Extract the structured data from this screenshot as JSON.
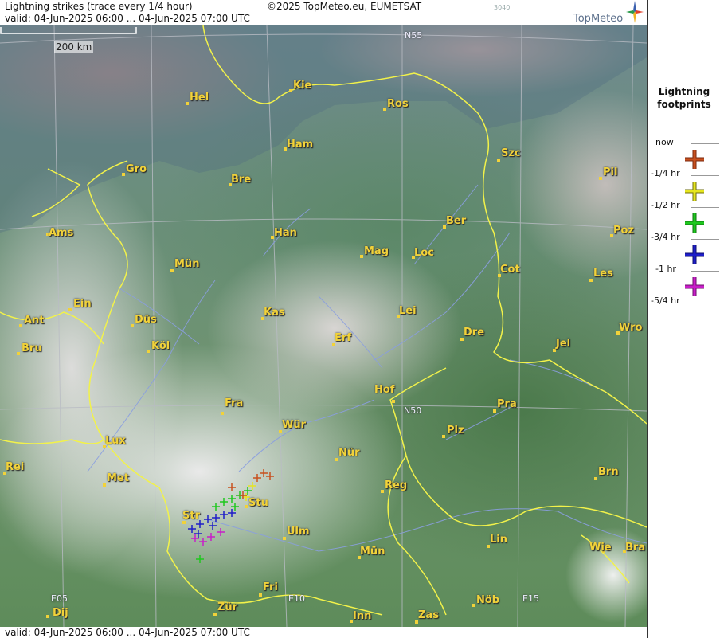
{
  "header": {
    "title": "Lightning strikes (trace every 1/4 hour)",
    "valid": "valid:  04-Jun-2025 06:00 ... 04-Jun-2025 07:00 UTC",
    "copyright": "©2025 TopMeteo.eu, EUMETSAT",
    "code": "3040",
    "brand": "TopMeteo"
  },
  "footer": {
    "valid": "valid:  04-Jun-2025 06:00 ... 04-Jun-2025 07:00 UTC"
  },
  "scale": {
    "label": "200 km"
  },
  "grid_labels": {
    "n55": "N55",
    "n50": "N50",
    "e05": "E05",
    "e10": "E10",
    "e15": "E15"
  },
  "cities": [
    {
      "id": "hel",
      "name": "Hel"
    },
    {
      "id": "kie",
      "name": "Kie"
    },
    {
      "id": "ros",
      "name": "Ros"
    },
    {
      "id": "ham",
      "name": "Ham"
    },
    {
      "id": "szc",
      "name": "Szc"
    },
    {
      "id": "gro",
      "name": "Gro"
    },
    {
      "id": "bre",
      "name": "Bre"
    },
    {
      "id": "pil",
      "name": "Pil"
    },
    {
      "id": "ber",
      "name": "Ber"
    },
    {
      "id": "ams",
      "name": "Ams"
    },
    {
      "id": "han",
      "name": "Han"
    },
    {
      "id": "poz",
      "name": "Poz"
    },
    {
      "id": "mun1",
      "name": "Mün"
    },
    {
      "id": "mag",
      "name": "Mag"
    },
    {
      "id": "loc",
      "name": "Loc"
    },
    {
      "id": "cot",
      "name": "Cot"
    },
    {
      "id": "les",
      "name": "Les"
    },
    {
      "id": "ein",
      "name": "Ein"
    },
    {
      "id": "kas",
      "name": "Kas"
    },
    {
      "id": "lei",
      "name": "Lei"
    },
    {
      "id": "ant",
      "name": "Ant"
    },
    {
      "id": "dus",
      "name": "Düs"
    },
    {
      "id": "wro",
      "name": "Wro"
    },
    {
      "id": "dre",
      "name": "Dre"
    },
    {
      "id": "bru",
      "name": "Bru"
    },
    {
      "id": "kol",
      "name": "Köl"
    },
    {
      "id": "erf",
      "name": "Erf"
    },
    {
      "id": "jel",
      "name": "Jel"
    },
    {
      "id": "hof",
      "name": "Hof"
    },
    {
      "id": "fra",
      "name": "Fra"
    },
    {
      "id": "pra",
      "name": "Pra"
    },
    {
      "id": "wur",
      "name": "Wür"
    },
    {
      "id": "lux",
      "name": "Lux"
    },
    {
      "id": "plz",
      "name": "Plz"
    },
    {
      "id": "nur",
      "name": "Nür"
    },
    {
      "id": "rei",
      "name": "Rei"
    },
    {
      "id": "met",
      "name": "Met"
    },
    {
      "id": "brn",
      "name": "Brn"
    },
    {
      "id": "reg",
      "name": "Reg"
    },
    {
      "id": "stu",
      "name": "Stu"
    },
    {
      "id": "str",
      "name": "Str"
    },
    {
      "id": "ulm",
      "name": "Ulm"
    },
    {
      "id": "lin",
      "name": "Lin"
    },
    {
      "id": "mun2",
      "name": "Mün"
    },
    {
      "id": "wie",
      "name": "Wie"
    },
    {
      "id": "bra",
      "name": "Bra"
    },
    {
      "id": "fri",
      "name": "Fri"
    },
    {
      "id": "dij",
      "name": "Dij"
    },
    {
      "id": "zur",
      "name": "Zür"
    },
    {
      "id": "nob",
      "name": "Nöb"
    },
    {
      "id": "inn",
      "name": "Inn"
    },
    {
      "id": "zas",
      "name": "Zas"
    }
  ],
  "legend": {
    "title_line1": "Lightning",
    "title_line2": "footprints",
    "items": [
      {
        "label": "now",
        "color": "#c8501e"
      },
      {
        "label": "-1/4 hr",
        "color": "#e6e61e"
      },
      {
        "label": "-1/2 hr",
        "color": "#1ec81e"
      },
      {
        "label": "-3/4 hr",
        "color": "#1e1ec8"
      },
      {
        "label": "-1 hr",
        "color": "#c81ec8"
      },
      {
        "label": "-5/4 hr",
        "color": ""
      }
    ]
  },
  "colors": {
    "city": "#f1d23a",
    "border": "#f2f24a",
    "river": "#8a9ee0",
    "grid": "#b9bcc4"
  }
}
